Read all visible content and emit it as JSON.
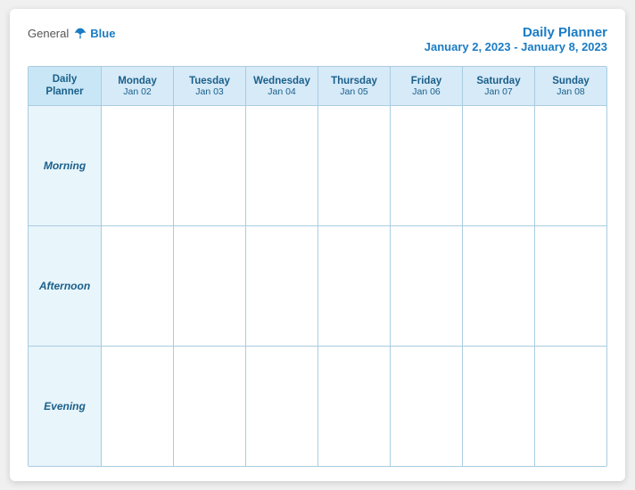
{
  "header": {
    "logo_general": "General",
    "logo_blue": "Blue",
    "title": "Daily Planner",
    "subtitle": "January 2, 2023 - January 8, 2023"
  },
  "columns": [
    {
      "day": "Daily\nPlanner",
      "date": "",
      "isLabel": true
    },
    {
      "day": "Monday",
      "date": "Jan 02"
    },
    {
      "day": "Tuesday",
      "date": "Jan 03"
    },
    {
      "day": "Wednesday",
      "date": "Jan 04"
    },
    {
      "day": "Thursday",
      "date": "Jan 05"
    },
    {
      "day": "Friday",
      "date": "Jan 06"
    },
    {
      "day": "Saturday",
      "date": "Jan 07"
    },
    {
      "day": "Sunday",
      "date": "Jan 08"
    }
  ],
  "rows": [
    {
      "label": "Morning"
    },
    {
      "label": "Afternoon"
    },
    {
      "label": "Evening"
    }
  ]
}
